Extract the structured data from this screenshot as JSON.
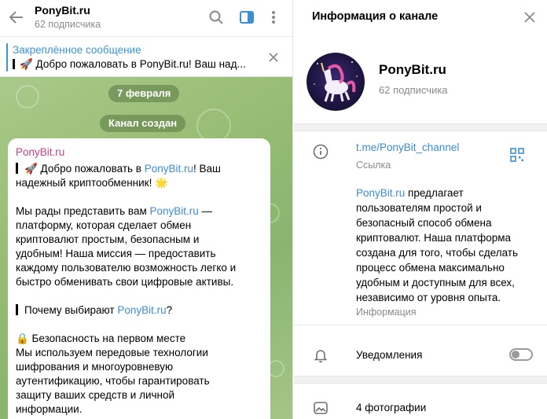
{
  "chat": {
    "title": "PonyBit.ru",
    "subscribers": "62 подписчика",
    "icons": [
      "back-arrow-icon",
      "search-icon",
      "sidebar-toggle-icon",
      "more-vertical-icon"
    ],
    "pinned": {
      "title": "Закреплённое сообщение",
      "text": "🚀 Добро пожаловать в PonyBit.ru! Ваш над..."
    },
    "date_pill": "7 февраля",
    "service_pill": "Канал создан",
    "message": {
      "author": "PonyBit.ru",
      "l1_prefix": "🚀 Добро пожаловать в ",
      "l1_link": "PonyBit.ru",
      "l1_suffix": "! Ваш",
      "l2": "надежный криптообменник! 🌟",
      "p2_l1_prefix": "Мы рады представить вам ",
      "p2_l1_link": "PonyBit.ru",
      "p2_l1_suffix": " —",
      "p2_l2": "платформу, которая сделает обмен",
      "p2_l3": "криптовалют простым, безопасным и",
      "p2_l4": "удобным! Наша миссия — предоставить",
      "p2_l5": "каждому пользователю возможность легко и",
      "p2_l6": "быстро обменивать свои цифровые активы.",
      "p3_prefix": "Почему выбирают ",
      "p3_link": "PonyBit.ru",
      "p3_suffix": "?",
      "p4_title": "🔒 Безопасность на первом месте",
      "p4_l1": "Мы используем передовые технологии",
      "p4_l2": "шифрования и многоуровневую",
      "p4_l3": "аутентификацию, чтобы гарантировать",
      "p4_l4": "защиту ваших средств и личной",
      "p4_l5": "информации."
    }
  },
  "info": {
    "title": "Информация о канале",
    "channel_name": "PonyBit.ru",
    "subscribers": "62 подписчика",
    "link": "t.me/PonyBit_channel",
    "link_caption": "Ссылка",
    "description_link": "PonyBit.ru",
    "description_l1": " предлагает",
    "description_l2": "пользователям простой и",
    "description_l3": "безопасный способ обмена",
    "description_l4": "криптовалют. Наша платформа",
    "description_l5": "создана для того, чтобы сделать",
    "description_l6": "процесс обмена максимально",
    "description_l7": "удобным и доступным для всех,",
    "description_l8": "независимо от уровня опыта.",
    "description_caption": "Информация",
    "notifications_label": "Уведомления",
    "notifications_enabled": false,
    "photos_label": "4 фотографии",
    "icons": [
      "close-icon",
      "info-icon",
      "qr-code-icon",
      "bell-icon",
      "photo-icon"
    ]
  },
  "colors": {
    "accent": "#3a8dd6",
    "author": "#c13f82",
    "chat_bg": "#98bd74"
  }
}
